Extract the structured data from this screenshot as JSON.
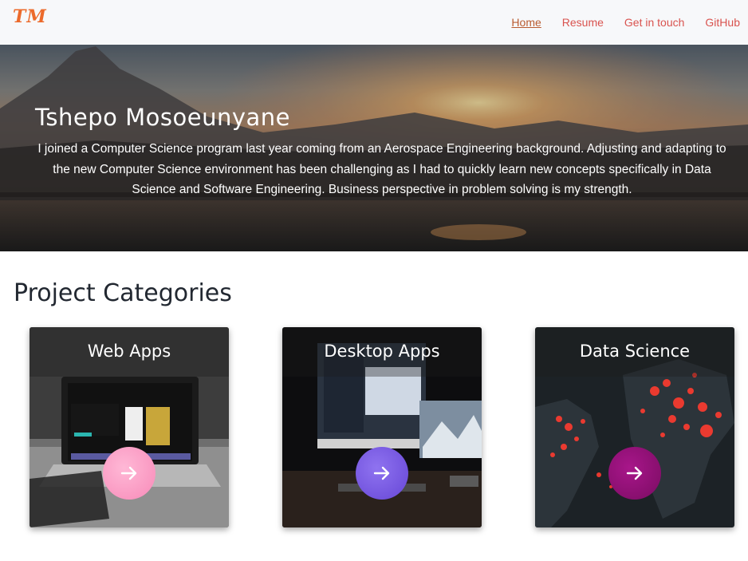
{
  "navbar": {
    "logo": "TM",
    "links": [
      {
        "label": "Home",
        "active": true
      },
      {
        "label": "Resume",
        "active": false
      },
      {
        "label": "Get in touch",
        "active": false
      },
      {
        "label": "GitHub",
        "active": false
      }
    ]
  },
  "hero": {
    "name": "Tshepo Mosoeunyane",
    "bio_lines": [
      "I joined a Computer Science program last year coming from an Aerospace Engineering background. Adjusting and adapting to",
      "the new Computer Science environment has been challenging as I had to quickly learn new concepts specifically in Data",
      "Science and Software Engineering. Business perspective in problem solving is my strength."
    ]
  },
  "projects": {
    "heading": "Project Categories",
    "cards": [
      {
        "title": "Web Apps",
        "button_icon": "arrow-right-icon",
        "button_color": "#ff9fc4"
      },
      {
        "title": "Desktop Apps",
        "button_icon": "arrow-right-icon",
        "button_color": "#7c5ce8"
      },
      {
        "title": "Data Science",
        "button_icon": "arrow-right-icon",
        "button_color": "#8a1070"
      }
    ]
  },
  "colors": {
    "logo": "#ec6a2b",
    "nav_link": "#d9534f",
    "nav_active": "#b95b30",
    "heading": "#222831"
  }
}
